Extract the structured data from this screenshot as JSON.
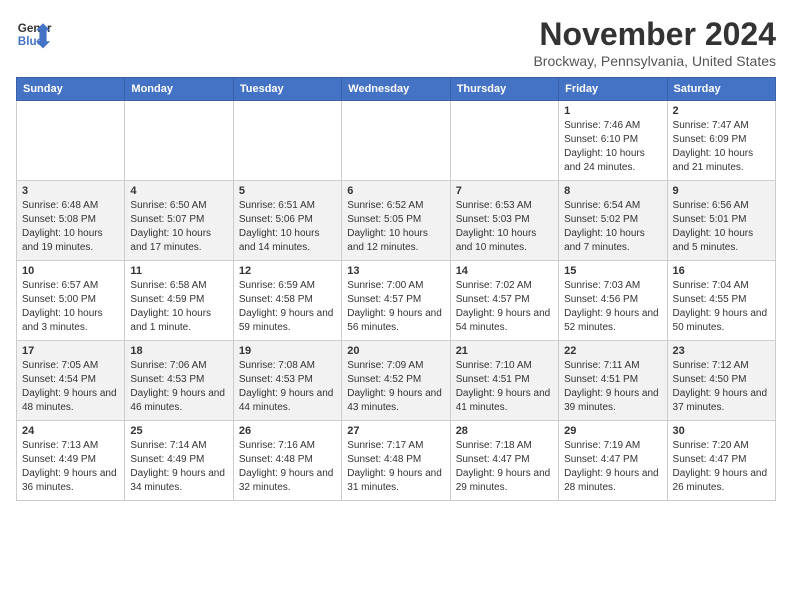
{
  "header": {
    "logo_line1": "General",
    "logo_line2": "Blue",
    "month_title": "November 2024",
    "location": "Brockway, Pennsylvania, United States"
  },
  "days_of_week": [
    "Sunday",
    "Monday",
    "Tuesday",
    "Wednesday",
    "Thursday",
    "Friday",
    "Saturday"
  ],
  "weeks": [
    [
      {
        "day": "",
        "info": ""
      },
      {
        "day": "",
        "info": ""
      },
      {
        "day": "",
        "info": ""
      },
      {
        "day": "",
        "info": ""
      },
      {
        "day": "",
        "info": ""
      },
      {
        "day": "1",
        "info": "Sunrise: 7:46 AM\nSunset: 6:10 PM\nDaylight: 10 hours and 24 minutes."
      },
      {
        "day": "2",
        "info": "Sunrise: 7:47 AM\nSunset: 6:09 PM\nDaylight: 10 hours and 21 minutes."
      }
    ],
    [
      {
        "day": "3",
        "info": "Sunrise: 6:48 AM\nSunset: 5:08 PM\nDaylight: 10 hours and 19 minutes."
      },
      {
        "day": "4",
        "info": "Sunrise: 6:50 AM\nSunset: 5:07 PM\nDaylight: 10 hours and 17 minutes."
      },
      {
        "day": "5",
        "info": "Sunrise: 6:51 AM\nSunset: 5:06 PM\nDaylight: 10 hours and 14 minutes."
      },
      {
        "day": "6",
        "info": "Sunrise: 6:52 AM\nSunset: 5:05 PM\nDaylight: 10 hours and 12 minutes."
      },
      {
        "day": "7",
        "info": "Sunrise: 6:53 AM\nSunset: 5:03 PM\nDaylight: 10 hours and 10 minutes."
      },
      {
        "day": "8",
        "info": "Sunrise: 6:54 AM\nSunset: 5:02 PM\nDaylight: 10 hours and 7 minutes."
      },
      {
        "day": "9",
        "info": "Sunrise: 6:56 AM\nSunset: 5:01 PM\nDaylight: 10 hours and 5 minutes."
      }
    ],
    [
      {
        "day": "10",
        "info": "Sunrise: 6:57 AM\nSunset: 5:00 PM\nDaylight: 10 hours and 3 minutes."
      },
      {
        "day": "11",
        "info": "Sunrise: 6:58 AM\nSunset: 4:59 PM\nDaylight: 10 hours and 1 minute."
      },
      {
        "day": "12",
        "info": "Sunrise: 6:59 AM\nSunset: 4:58 PM\nDaylight: 9 hours and 59 minutes."
      },
      {
        "day": "13",
        "info": "Sunrise: 7:00 AM\nSunset: 4:57 PM\nDaylight: 9 hours and 56 minutes."
      },
      {
        "day": "14",
        "info": "Sunrise: 7:02 AM\nSunset: 4:57 PM\nDaylight: 9 hours and 54 minutes."
      },
      {
        "day": "15",
        "info": "Sunrise: 7:03 AM\nSunset: 4:56 PM\nDaylight: 9 hours and 52 minutes."
      },
      {
        "day": "16",
        "info": "Sunrise: 7:04 AM\nSunset: 4:55 PM\nDaylight: 9 hours and 50 minutes."
      }
    ],
    [
      {
        "day": "17",
        "info": "Sunrise: 7:05 AM\nSunset: 4:54 PM\nDaylight: 9 hours and 48 minutes."
      },
      {
        "day": "18",
        "info": "Sunrise: 7:06 AM\nSunset: 4:53 PM\nDaylight: 9 hours and 46 minutes."
      },
      {
        "day": "19",
        "info": "Sunrise: 7:08 AM\nSunset: 4:53 PM\nDaylight: 9 hours and 44 minutes."
      },
      {
        "day": "20",
        "info": "Sunrise: 7:09 AM\nSunset: 4:52 PM\nDaylight: 9 hours and 43 minutes."
      },
      {
        "day": "21",
        "info": "Sunrise: 7:10 AM\nSunset: 4:51 PM\nDaylight: 9 hours and 41 minutes."
      },
      {
        "day": "22",
        "info": "Sunrise: 7:11 AM\nSunset: 4:51 PM\nDaylight: 9 hours and 39 minutes."
      },
      {
        "day": "23",
        "info": "Sunrise: 7:12 AM\nSunset: 4:50 PM\nDaylight: 9 hours and 37 minutes."
      }
    ],
    [
      {
        "day": "24",
        "info": "Sunrise: 7:13 AM\nSunset: 4:49 PM\nDaylight: 9 hours and 36 minutes."
      },
      {
        "day": "25",
        "info": "Sunrise: 7:14 AM\nSunset: 4:49 PM\nDaylight: 9 hours and 34 minutes."
      },
      {
        "day": "26",
        "info": "Sunrise: 7:16 AM\nSunset: 4:48 PM\nDaylight: 9 hours and 32 minutes."
      },
      {
        "day": "27",
        "info": "Sunrise: 7:17 AM\nSunset: 4:48 PM\nDaylight: 9 hours and 31 minutes."
      },
      {
        "day": "28",
        "info": "Sunrise: 7:18 AM\nSunset: 4:47 PM\nDaylight: 9 hours and 29 minutes."
      },
      {
        "day": "29",
        "info": "Sunrise: 7:19 AM\nSunset: 4:47 PM\nDaylight: 9 hours and 28 minutes."
      },
      {
        "day": "30",
        "info": "Sunrise: 7:20 AM\nSunset: 4:47 PM\nDaylight: 9 hours and 26 minutes."
      }
    ]
  ]
}
